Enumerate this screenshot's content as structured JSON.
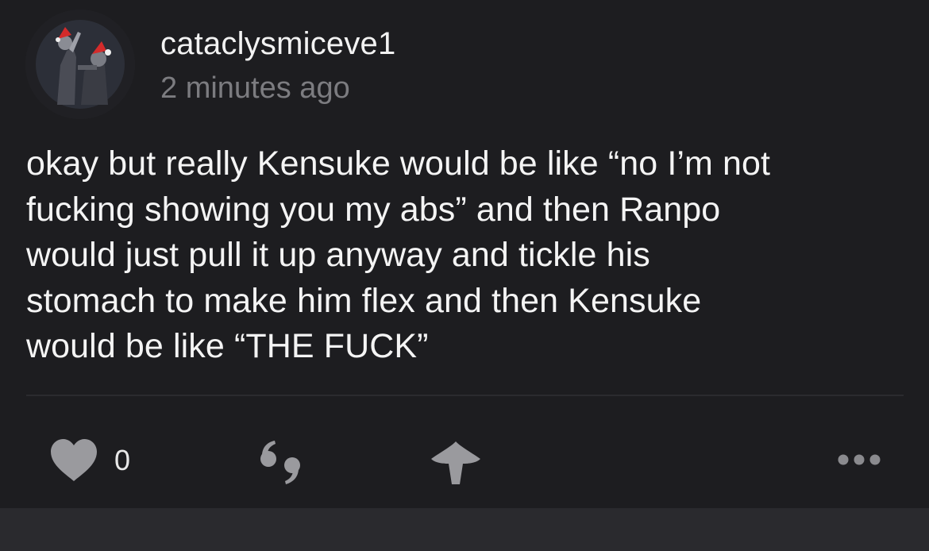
{
  "post": {
    "username": "cataclysmiceve1",
    "timestamp": "2 minutes ago",
    "body_lines": [
      "okay but really Kensuke would be like “no I’m not",
      "fucking showing you my abs” and then Ranpo",
      "would just pull it up anyway and tickle his",
      "stomach to make him flex and then Kensuke",
      "would be like “THE FUCK”"
    ]
  },
  "actions": {
    "like_icon": "heart-icon",
    "like_count": "0",
    "reblog_icon": "quote-icon",
    "share_icon": "upvote-arrow-icon",
    "more_icon": "ellipsis-icon"
  },
  "colors": {
    "background": "#1d1d20",
    "text": "#f4f4f4",
    "muted": "#7c7c80",
    "icon": "#9a9a9e",
    "footer": "#2a2a2e"
  }
}
